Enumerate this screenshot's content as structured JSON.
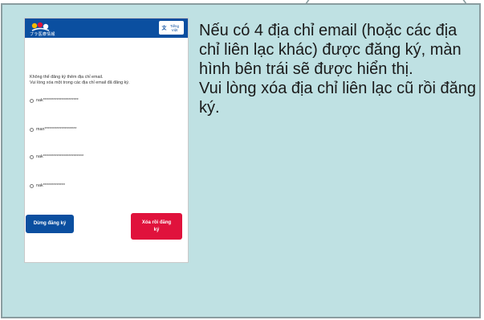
{
  "colors": {
    "panel_bg": "#bfe1e3",
    "header_blue": "#0b4fa0",
    "stop_button": "#0b4fa0",
    "delete_button": "#e0123c"
  },
  "phone": {
    "header": {
      "logo_icon": "app-logo-icon",
      "logo_caption": "ブラ医療情報",
      "language_button": {
        "icon": "translate-icon",
        "label": "Tiếng Việt"
      }
    },
    "message": {
      "line1": "Không thể đăng ký thêm địa chỉ email.",
      "line2": "Vui lòng xóa một trong các địa chỉ email đã đăng ký."
    },
    "options": [
      {
        "label": "nak*********************"
      },
      {
        "label": "man*******************"
      },
      {
        "label": "nak************************"
      },
      {
        "label": "nak*************"
      }
    ],
    "buttons": {
      "stop": "Dừng đăng ký",
      "delete_line1": "Xóa rồi đăng",
      "delete_line2": "ký"
    }
  },
  "description": {
    "para1": "Nếu có 4 địa chỉ email (hoặc các địa chỉ liên lạc khác) được đăng ký, màn hình bên trái sẽ được hiển thị.",
    "para2": "Vui lòng xóa địa chỉ liên lạc cũ rồi đăng ký."
  }
}
